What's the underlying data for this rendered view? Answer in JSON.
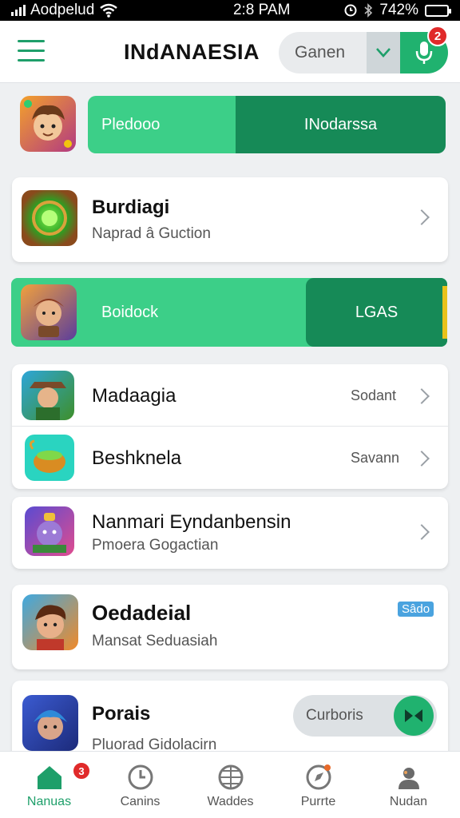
{
  "status_bar": {
    "carrier": "Aodpelud",
    "time": "2:8 PAM",
    "battery": "742%",
    "icons": [
      "signal-icon",
      "wifi-icon",
      "alarm-icon",
      "bluetooth-icon",
      "battery-icon"
    ]
  },
  "header": {
    "title": "INdANAESIA",
    "search_text": "Ganen",
    "notification_count": "2",
    "icons": [
      "menu-icon",
      "chevron-down-icon",
      "mic-icon"
    ]
  },
  "banner1": {
    "left_label": "Pledooo",
    "right_label": "INodarssa"
  },
  "card1": {
    "title": "Burdiagi",
    "subtitle": "Naprad â Guction"
  },
  "banner2": {
    "left_label": "Boidock",
    "right_label": "LGAS"
  },
  "card2": {
    "rows": [
      {
        "title": "Madaagia",
        "side": "Sodant"
      },
      {
        "title": "Beshknela",
        "side": "Savann"
      }
    ]
  },
  "card3": {
    "title": "Nanmari Eyndanbensin",
    "subtitle": "Pmoera Gogactian"
  },
  "card4": {
    "title": "Oedadeial",
    "subtitle": "Mansat Seduasiah",
    "tag": "Sâdo"
  },
  "card5": {
    "title": "Porais",
    "subtitle": "Pluorad Gidolacirn",
    "toggle_label": "Curboris"
  },
  "bottom_nav": {
    "items": [
      {
        "label": "Nanuas",
        "icon": "home-icon",
        "badge": "3"
      },
      {
        "label": "Canins",
        "icon": "clock-icon"
      },
      {
        "label": "Waddes",
        "icon": "grid-globe-icon"
      },
      {
        "label": "Purrte",
        "icon": "compass-icon"
      },
      {
        "label": "Nudan",
        "icon": "profile-icon"
      }
    ]
  },
  "colors": {
    "accent": "#1e9f6a",
    "accent_light": "#3ccf88",
    "accent_dark": "#168a57",
    "badge": "#e02a2a",
    "tag": "#4aa3df"
  }
}
